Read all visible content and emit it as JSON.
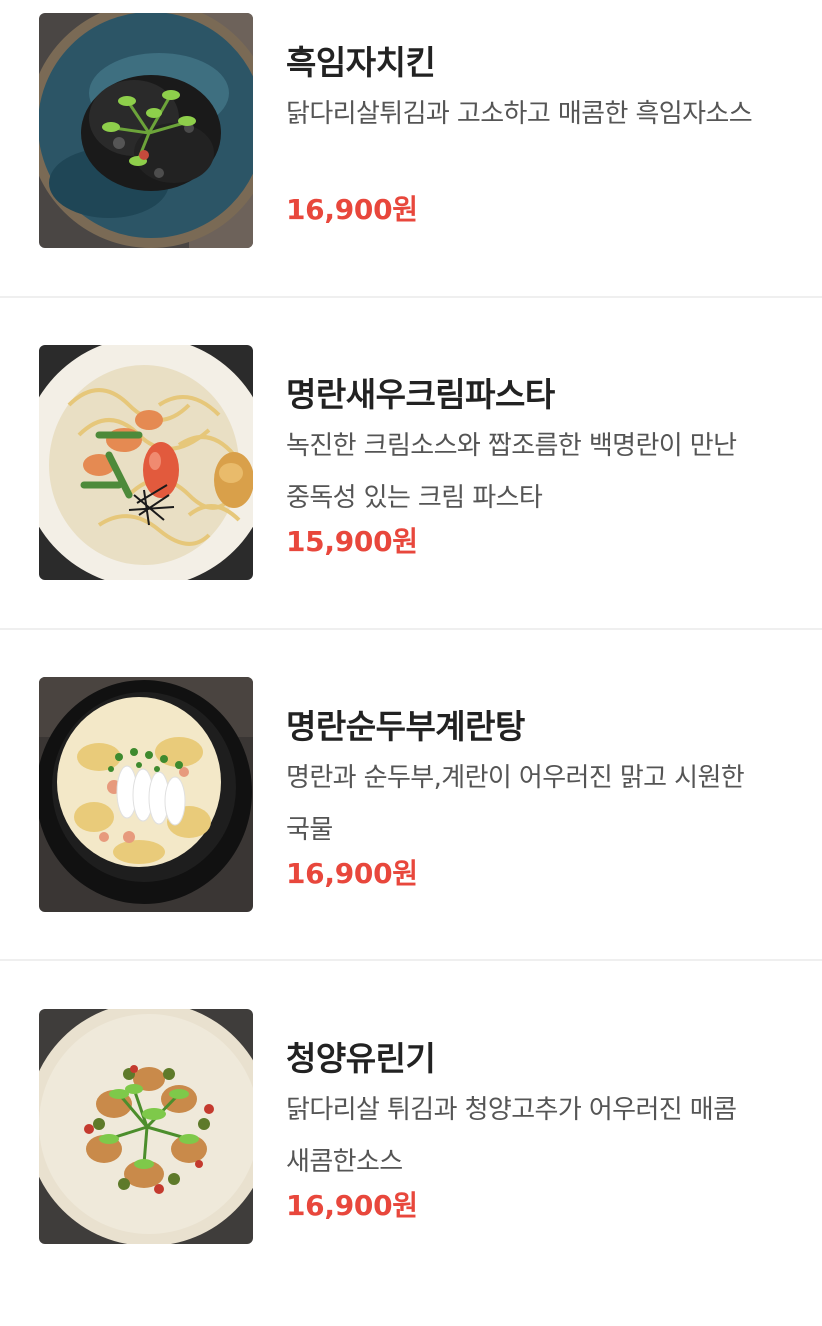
{
  "menu": {
    "items": [
      {
        "name": "흑임자치킨",
        "description": "닭다리살튀김과 고소하고 매콤한 흑임자소스",
        "price": "16,900원",
        "image": "fried-chicken-black-sesame-photo"
      },
      {
        "name": "명란새우크림파스타",
        "description": "녹진한 크림소스와 짭조름한 백명란이 만난 중독성 있는 크림 파스타",
        "price": "15,900원",
        "image": "cream-pasta-shrimp-photo"
      },
      {
        "name": "명란순두부계란탕",
        "description": "명란과 순두부,계란이 어우러진 맑고 시원한 국물",
        "price": "16,900원",
        "image": "tofu-egg-soup-photo"
      },
      {
        "name": "청양유린기",
        "description": "닭다리살 튀김과 청양고추가 어우러진 매콤 새콤한소스",
        "price": "16,900원",
        "image": "yuringi-chicken-photo"
      }
    ]
  },
  "colors": {
    "price": "#e8473c",
    "title": "#222222",
    "description": "#555555",
    "divider": "#efefef"
  }
}
